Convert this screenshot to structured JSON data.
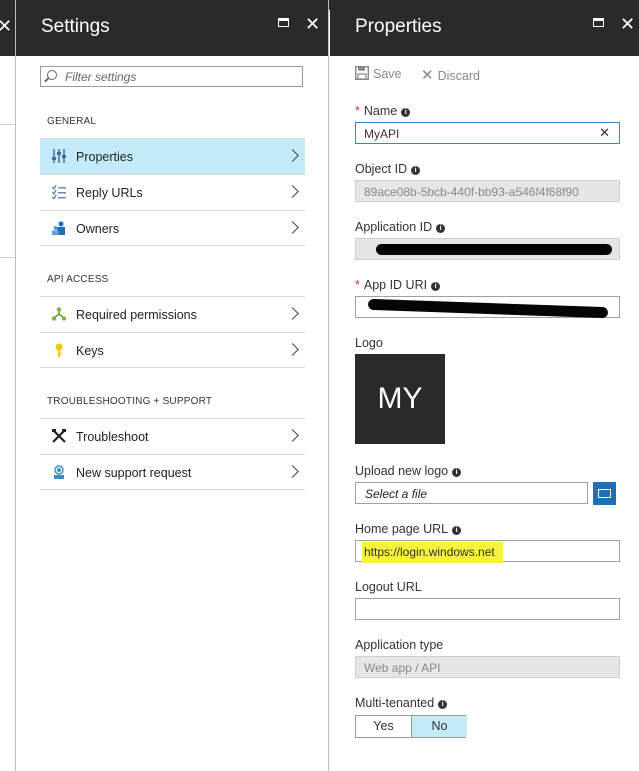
{
  "settings": {
    "title": "Settings",
    "filter_placeholder": "Filter settings",
    "sections": [
      {
        "label": "GENERAL",
        "items": [
          {
            "label": "Properties",
            "icon": "properties-icon"
          },
          {
            "label": "Reply URLs",
            "icon": "reply-urls-icon"
          },
          {
            "label": "Owners",
            "icon": "owners-icon"
          }
        ]
      },
      {
        "label": "API ACCESS",
        "items": [
          {
            "label": "Required permissions",
            "icon": "permissions-icon"
          },
          {
            "label": "Keys",
            "icon": "key-icon"
          }
        ]
      },
      {
        "label": "TROUBLESHOOTING + SUPPORT",
        "items": [
          {
            "label": "Troubleshoot",
            "icon": "tools-icon"
          },
          {
            "label": "New support request",
            "icon": "support-icon"
          }
        ]
      }
    ]
  },
  "properties": {
    "title": "Properties",
    "save_label": "Save",
    "discard_label": "Discard",
    "name_label": "Name",
    "name_value": "MyAPI",
    "object_id_label": "Object ID",
    "object_id_value": "89ace08b-5bcb-440f-bb93-a546f4f68f90",
    "application_id_label": "Application ID",
    "app_id_uri_label": "App ID URI",
    "logo_label": "Logo",
    "logo_text": "MY",
    "upload_logo_label": "Upload new logo",
    "upload_placeholder": "Select a file",
    "home_page_label": "Home page URL",
    "home_page_value": "https://login.windows.net",
    "logout_label": "Logout URL",
    "logout_value": "",
    "app_type_label": "Application type",
    "app_type_value": "Web app / API",
    "multi_tenanted_label": "Multi-tenanted",
    "yes_label": "Yes",
    "no_label": "No"
  },
  "colors": {
    "header": "#2a2a2a",
    "selected": "#c3ebf7",
    "required": "#d13438",
    "highlight": "#f8f33a",
    "accent": "#1f6fb5"
  }
}
